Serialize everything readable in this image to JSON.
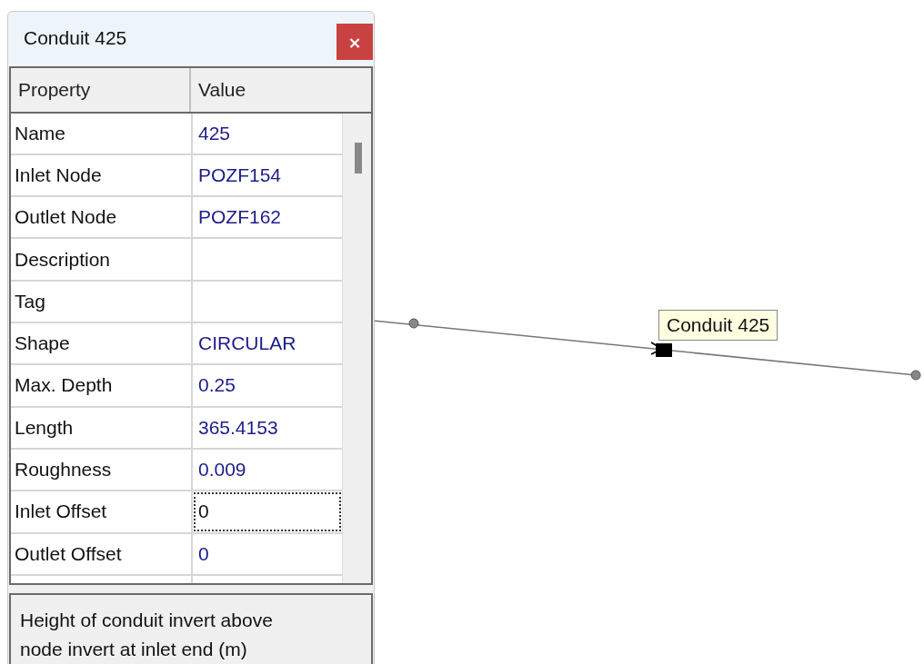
{
  "window": {
    "title": "Conduit 425",
    "close": "×"
  },
  "table": {
    "columns": [
      "Property",
      "Value"
    ],
    "rows": [
      {
        "property": "Name",
        "value": "425",
        "selected": false
      },
      {
        "property": "Inlet Node",
        "value": "POZF154",
        "selected": false
      },
      {
        "property": "Outlet Node",
        "value": "POZF162",
        "selected": false
      },
      {
        "property": "Description",
        "selected": false
      },
      {
        "property": "Tag",
        "selected": false
      },
      {
        "property": "Shape",
        "value": "CIRCULAR",
        "selected": false
      },
      {
        "property": "Max. Depth",
        "value": "0.25",
        "selected": false
      },
      {
        "property": "Length",
        "value": "365.4153",
        "selected": false
      },
      {
        "property": "Roughness",
        "value": "0.009",
        "selected": false
      },
      {
        "property": "Inlet Offset",
        "value": "0",
        "selected": true
      },
      {
        "property": "Outlet Offset",
        "value": "0",
        "selected": false
      }
    ]
  },
  "description": "Height of conduit invert above node invert at inlet end (m)",
  "map": {
    "tooltip": "Conduit 425"
  }
}
